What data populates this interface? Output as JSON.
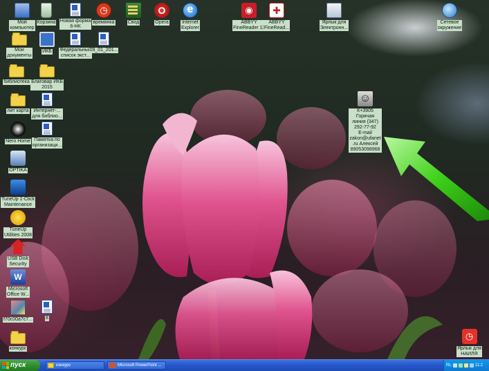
{
  "desktop_icons": [
    {
      "label": "Мой\nкомпьютер",
      "icon": "my-computer-icon"
    },
    {
      "label": "Корзина",
      "icon": "recycle-bin-icon"
    },
    {
      "label": "Новая форма\n6-НК",
      "icon": "word-document-icon"
    },
    {
      "label": "времянка",
      "icon": "red-app-icon"
    },
    {
      "label": "Свод",
      "icon": "svod-app-icon"
    },
    {
      "label": "Opera",
      "icon": "opera-icon"
    },
    {
      "label": "Internet\nExplorer",
      "icon": "internet-explorer-icon"
    },
    {
      "label": "ABBYY\nFineReader 11",
      "icon": "abbyy-finereader-icon"
    },
    {
      "label": "ABBYY\nFineRead...",
      "icon": "abbyy-finereader-icon"
    },
    {
      "label": "Ярлык для\nЭлектронн...",
      "icon": "shortcut-icon"
    },
    {
      "label": "Сетевое\nокружение",
      "icon": "network-places-icon"
    },
    {
      "label": "Мои\nдокументы",
      "icon": "my-documents-icon"
    },
    {
      "label": "ИКБ",
      "icon": "monitor-icon"
    },
    {
      "label": "Федеральный\nсписок экст...",
      "icon": "word-document-icon"
    },
    {
      "label": "09_01_201...",
      "icon": "excel-document-icon"
    },
    {
      "label": "библиотека",
      "icon": "folder-icon"
    },
    {
      "label": "Благовар ИКБ\n2015",
      "icon": "folder-icon"
    },
    {
      "label": "лит карта",
      "icon": "folder-icon"
    },
    {
      "label": "Интернет-...\nдля библио...",
      "icon": "word-document-icon"
    },
    {
      "label": "К+3905\nГорячая\nлиния (347)\n292-77-92\nE-mail\nzakon@ufanet\n.ru Алексей\n89053098968",
      "icon": "contact-shortcut-icon"
    },
    {
      "label": "Nero Home",
      "icon": "nero-icon"
    },
    {
      "label": "Памятка по\nорганизаци...",
      "icon": "word-document-icon"
    },
    {
      "label": "OPTIKA",
      "icon": "optika-icon"
    },
    {
      "label": "TuneUp 1-Click\nMaintenance",
      "icon": "tuneup-icon"
    },
    {
      "label": "TuneUp\nUtilities 2008",
      "icon": "tuneup-utilities-icon"
    },
    {
      "label": "USB Disk\nSecurity",
      "icon": "usb-disk-security-icon"
    },
    {
      "label": "Microsoft\nOffice W...",
      "icon": "ms-office-word-icon"
    },
    {
      "label": "f70c00a7c7...",
      "icon": "image-file-icon"
    },
    {
      "label": "8",
      "icon": "word-document-icon"
    },
    {
      "label": "конкурс",
      "icon": "folder-icon"
    },
    {
      "label": "Ярлык для\nНАИЛЯ",
      "icon": "yandex-shortcut-icon"
    }
  ],
  "taskbar": {
    "start_label": "пуск",
    "tasks": [
      {
        "label": "конкурс",
        "icon": "folder-icon"
      },
      {
        "label": "Microsoft PowerPoint ...",
        "icon": "powerpoint-icon"
      }
    ],
    "tray": {
      "language": "RL",
      "clock": "11:2"
    }
  },
  "colors": {
    "label_bg": "#c9dfc9",
    "taskbar": "#2556c9",
    "start_button": "#2d8c2d",
    "tray": "#0c7ad0",
    "arrow": "#3fd21a"
  }
}
